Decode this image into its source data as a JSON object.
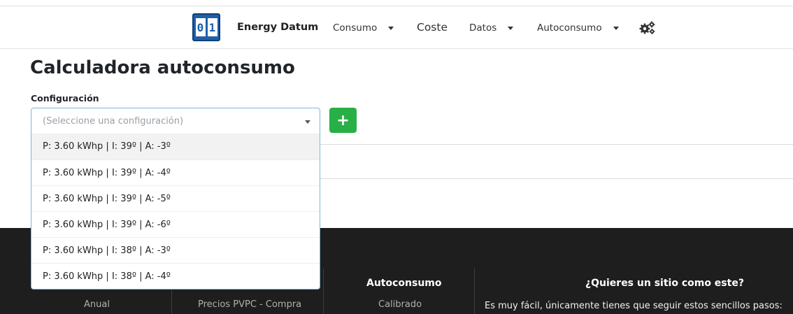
{
  "navbar": {
    "logo_digits": [
      "0",
      "1"
    ],
    "brand": "Energy Datum",
    "items": [
      {
        "label": "Consumo",
        "has_caret": true
      },
      {
        "label": "Coste",
        "has_caret": false
      },
      {
        "label": "Datos",
        "has_caret": true
      },
      {
        "label": "Autoconsumo",
        "has_caret": true
      }
    ],
    "settings_icon": "gears-icon"
  },
  "main": {
    "title": "Calculadora autoconsumo",
    "config_label": "Configuración",
    "select_placeholder": "(Seleccione una configuración)",
    "add_button_label": "+",
    "options": [
      "P: 3.60 kWhp | I: 39º | A: -3º",
      "P: 3.60 kWhp | I: 39º | A: -4º",
      "P: 3.60 kWhp | I: 39º | A: -5º",
      "P: 3.60 kWhp | I: 39º | A: -6º",
      "P: 3.60 kWhp | I: 38º | A: -3º",
      "P: 3.60 kWhp | I: 38º | A: -4º"
    ],
    "highlighted_option_index": 0
  },
  "footer": {
    "col1_link": "Anual",
    "col2_link": "Precios PVPC - Compra",
    "col3_heading": "Autoconsumo",
    "col3_link": "Calibrado",
    "col4_heading": "¿Quieres un sitio como este?",
    "col4_text": "Es muy fácil, únicamente tienes que seguir estos sencillos pasos:"
  },
  "colors": {
    "brand_blue": "#1f5fa8",
    "add_green": "#28b046",
    "footer_bg": "#1e1e1e",
    "select_border": "#7cb8d8"
  }
}
